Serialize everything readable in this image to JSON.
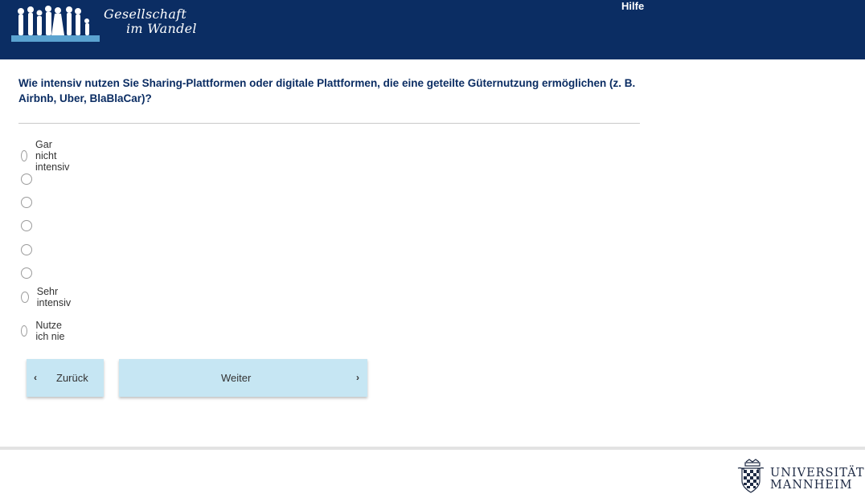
{
  "header": {
    "logo_line1": "Gesellschaft",
    "logo_line2": "im Wandel",
    "help_label": "Hilfe",
    "background_color": "#0b2d63"
  },
  "question": {
    "text": "Wie intensiv nutzen Sie Sharing-Plattformen oder digitale Plattformen, die eine geteilte Güternutzung ermöglichen (z. B. Airbnb, Uber, BlaBlaCar)?"
  },
  "options": [
    {
      "label": "Gar nicht intensiv",
      "selected": false
    },
    {
      "label": "",
      "selected": false
    },
    {
      "label": "",
      "selected": false
    },
    {
      "label": "",
      "selected": false
    },
    {
      "label": "",
      "selected": false
    },
    {
      "label": "",
      "selected": false
    },
    {
      "label": "Sehr intensiv",
      "selected": false
    },
    {
      "label": "Nutze ich nie",
      "selected": false
    }
  ],
  "navigation": {
    "back_label": "Zurück",
    "next_label": "Weiter",
    "back_icon": "chevron-left-icon",
    "next_icon": "chevron-right-icon",
    "button_color": "#c6e6f3"
  },
  "footer": {
    "university_line1": "UNIVERSITÄT",
    "university_line2": "MANNHEIM"
  }
}
